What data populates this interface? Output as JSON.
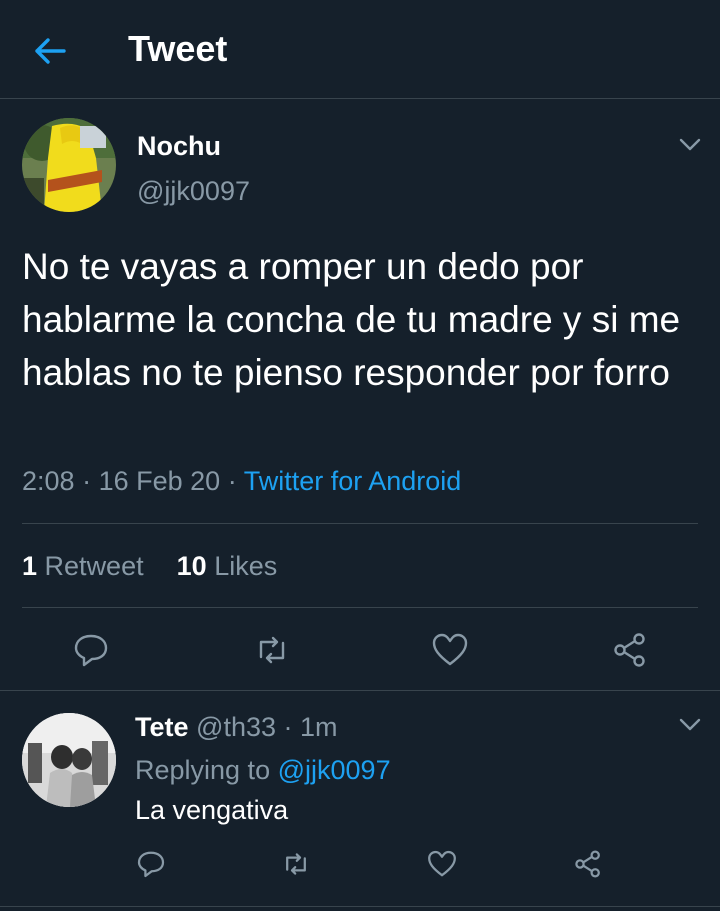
{
  "header": {
    "title": "Tweet",
    "back_icon": "arrow-left-icon"
  },
  "tweet": {
    "name": "Nochu",
    "handle": "@jjk0097",
    "text": "No te vayas a romper un dedo por hablarme la concha de tu madre y si me hablas no te pienso responder por forro",
    "time": "2:08",
    "date": "16 Feb 20",
    "source": "Twitter for Android",
    "separator": "·",
    "retweet_count": "1",
    "retweet_label": "Retweet",
    "like_count": "10",
    "like_label": "Likes"
  },
  "reply": {
    "name": "Tete",
    "handle": "@th33",
    "time": "1m",
    "replying_prefix": "Replying to",
    "replying_handle": "@jjk0097",
    "text": "La vengativa"
  },
  "colors": {
    "background": "#15202b",
    "accent": "#1da1f2",
    "muted": "#8899a6",
    "divider": "#38444d"
  }
}
